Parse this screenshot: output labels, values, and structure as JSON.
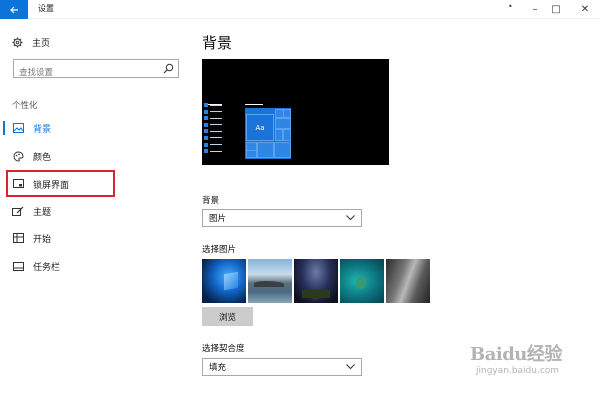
{
  "window": {
    "title": "设置",
    "extra": "•",
    "minimize": "–",
    "maximize": "□",
    "close": "✕"
  },
  "sidebar": {
    "home_label": "主页",
    "search_placeholder": "查找设置",
    "section_label": "个性化",
    "items": [
      {
        "label": "背景",
        "icon": "picture-icon",
        "active": true
      },
      {
        "label": "颜色",
        "icon": "palette-icon",
        "active": false
      },
      {
        "label": "锁屏界面",
        "icon": "lock-screen-icon",
        "active": false,
        "highlighted": true
      },
      {
        "label": "主题",
        "icon": "brush-icon",
        "active": false
      },
      {
        "label": "开始",
        "icon": "start-icon",
        "active": false
      },
      {
        "label": "任务栏",
        "icon": "taskbar-icon",
        "active": false
      }
    ]
  },
  "main": {
    "title": "背景",
    "preview_tile_text": "Aa",
    "background_label": "背景",
    "background_value": "图片",
    "choose_picture_label": "选择图片",
    "browse_label": "浏览",
    "fit_label": "选择契合度",
    "fit_value": "填充"
  },
  "watermark": {
    "logo": "Baidu经验",
    "url": "jingyan.baidu.com"
  },
  "colors": {
    "accent": "#0a74da",
    "highlight": "#d9232e"
  }
}
